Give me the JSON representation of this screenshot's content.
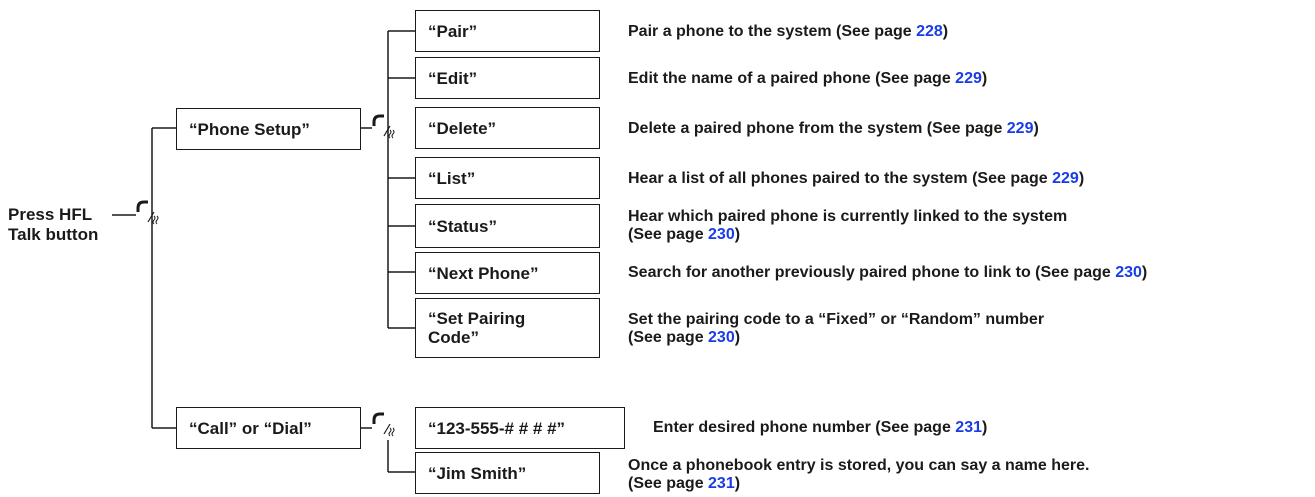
{
  "start": {
    "line1": "Press HFL",
    "line2": "Talk button"
  },
  "branches": [
    {
      "label": "“Phone Setup”"
    },
    {
      "label": "“Call” or “Dial”"
    }
  ],
  "phone_setup_items": [
    {
      "label": "“Pair”",
      "desc": "Pair a phone to the system (See page ",
      "page": "228",
      "tail": ")"
    },
    {
      "label": "“Edit”",
      "desc": "Edit the name of a paired phone (See page ",
      "page": "229",
      "tail": ")"
    },
    {
      "label": "“Delete”",
      "desc": "Delete a paired phone from the system (See page ",
      "page": "229",
      "tail": ")"
    },
    {
      "label": "“List”",
      "desc": "Hear a list of all phones paired to the system (See page ",
      "page": "229",
      "tail": ")"
    },
    {
      "label": "“Status”",
      "desc": "Hear which paired phone is currently linked to the system",
      "desc2": "(See page ",
      "page": "230",
      "tail": ")"
    },
    {
      "label": "“Next Phone”",
      "desc": "Search for another previously paired phone to link to (See page ",
      "page": "230",
      "tail": ")"
    },
    {
      "label": "“Set Pairing\n Code”",
      "desc": "Set the pairing code to a “Fixed” or “Random” number",
      "desc2": "(See page ",
      "page": "230",
      "tail": ")"
    }
  ],
  "call_items": [
    {
      "label": "“123-555-# # # #”",
      "desc": "Enter desired phone number (See page ",
      "page": "231",
      "tail": ")"
    },
    {
      "label": "“Jim Smith”",
      "desc": "Once a phonebook entry is stored, you can say a name here.",
      "desc2": "(See page ",
      "page": "231",
      "tail": ")"
    }
  ],
  "colors": {
    "link": "#1a3be8",
    "ink": "#1a1a1a"
  },
  "icons": [
    "talk-icon"
  ]
}
